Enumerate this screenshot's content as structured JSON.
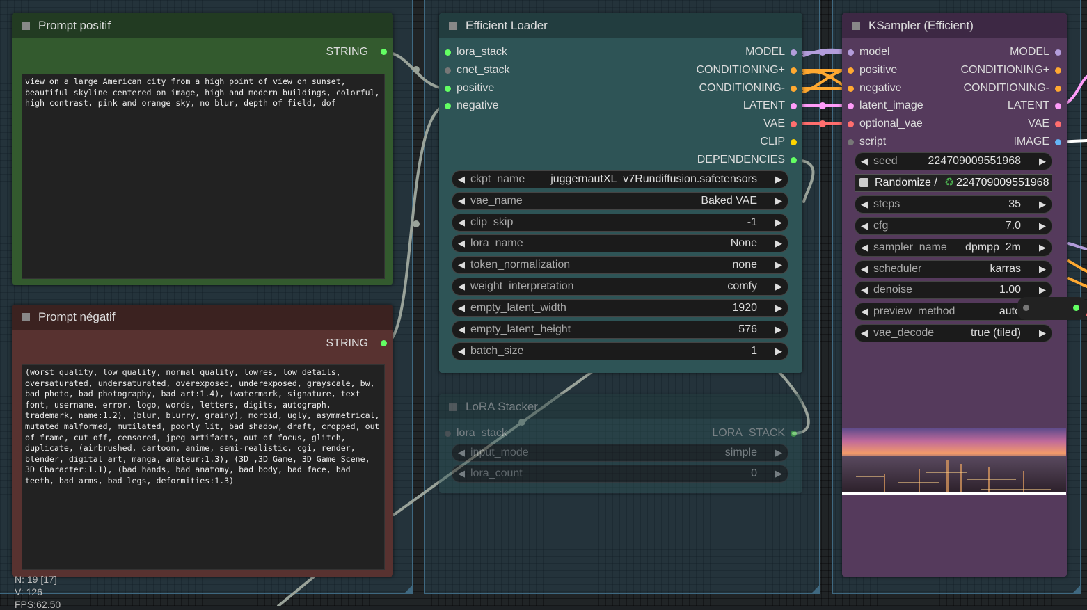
{
  "colors": {
    "model": "#b39ddb",
    "conditioning": "#ffa931",
    "latent": "#ff9cf9",
    "vae": "#ff6e6e",
    "clip": "#ffd500",
    "string": "#63ff63",
    "image": "#64b5f6",
    "lora": "#63ff63"
  },
  "prompt_pos": {
    "title": "Prompt positif",
    "output": "STRING",
    "text": "view on a large American city from a high point of view on sunset, beautiful skyline centered on image, high and modern buildings, colorful, high contrast, pink and orange sky, no blur, depth of field, dof"
  },
  "prompt_neg": {
    "title": "Prompt négatif",
    "output": "STRING",
    "text": "(worst quality, low quality, normal quality, lowres, low details, oversaturated, undersaturated, overexposed, underexposed, grayscale, bw, bad photo, bad photography, bad art:1.4), (watermark, signature, text font, username, error, logo, words, letters, digits, autograph, trademark, name:1.2), (blur, blurry, grainy), morbid, ugly, asymmetrical, mutated malformed, mutilated, poorly lit, bad shadow, draft, cropped, out of frame, cut off, censored, jpeg artifacts, out of focus, glitch, duplicate, (airbrushed, cartoon, anime, semi-realistic, cgi, render, blender, digital art, manga, amateur:1.3), (3D ,3D Game, 3D Game Scene, 3D Character:1.1), (bad hands, bad anatomy, bad body, bad face, bad teeth, bad arms, bad legs, deformities:1.3)"
  },
  "loader": {
    "title": "Efficient Loader",
    "inputs": [
      "lora_stack",
      "cnet_stack",
      "positive",
      "negative"
    ],
    "outputs": [
      "MODEL",
      "CONDITIONING+",
      "CONDITIONING-",
      "LATENT",
      "VAE",
      "CLIP",
      "DEPENDENCIES"
    ],
    "widgets": [
      {
        "label": "ckpt_name",
        "value": "juggernautXL_v7Rundiffusion.safetensors"
      },
      {
        "label": "vae_name",
        "value": "Baked VAE"
      },
      {
        "label": "clip_skip",
        "value": "-1"
      },
      {
        "label": "lora_name",
        "value": "None"
      },
      {
        "label": "token_normalization",
        "value": "none"
      },
      {
        "label": "weight_interpretation",
        "value": "comfy"
      },
      {
        "label": "empty_latent_width",
        "value": "1920"
      },
      {
        "label": "empty_latent_height",
        "value": "576"
      },
      {
        "label": "batch_size",
        "value": "1"
      }
    ]
  },
  "stacker": {
    "title": "LoRA Stacker",
    "input": "lora_stack",
    "output": "LORA_STACK",
    "widgets": [
      {
        "label": "input_mode",
        "value": "simple"
      },
      {
        "label": "lora_count",
        "value": "0"
      }
    ]
  },
  "ksampler": {
    "title": "KSampler (Efficient)",
    "inputs": [
      "model",
      "positive",
      "negative",
      "latent_image",
      "optional_vae",
      "script"
    ],
    "outputs": [
      "MODEL",
      "CONDITIONING+",
      "CONDITIONING-",
      "LATENT",
      "VAE",
      "IMAGE"
    ],
    "seed": {
      "label": "seed",
      "value": "224709009551968"
    },
    "randomize": {
      "label": "Randomize /",
      "value": "224709009551968"
    },
    "widgets": [
      {
        "label": "steps",
        "value": "35"
      },
      {
        "label": "cfg",
        "value": "7.0"
      },
      {
        "label": "sampler_name",
        "value": "dpmpp_2m"
      },
      {
        "label": "scheduler",
        "value": "karras"
      },
      {
        "label": "denoise",
        "value": "1.00"
      },
      {
        "label": "preview_method",
        "value": "auto"
      },
      {
        "label": "vae_decode",
        "value": "true (tiled)"
      }
    ]
  },
  "stats": {
    "n": "N: 19 [17]",
    "v": "V: 126",
    "fps": "FPS:62.50"
  }
}
